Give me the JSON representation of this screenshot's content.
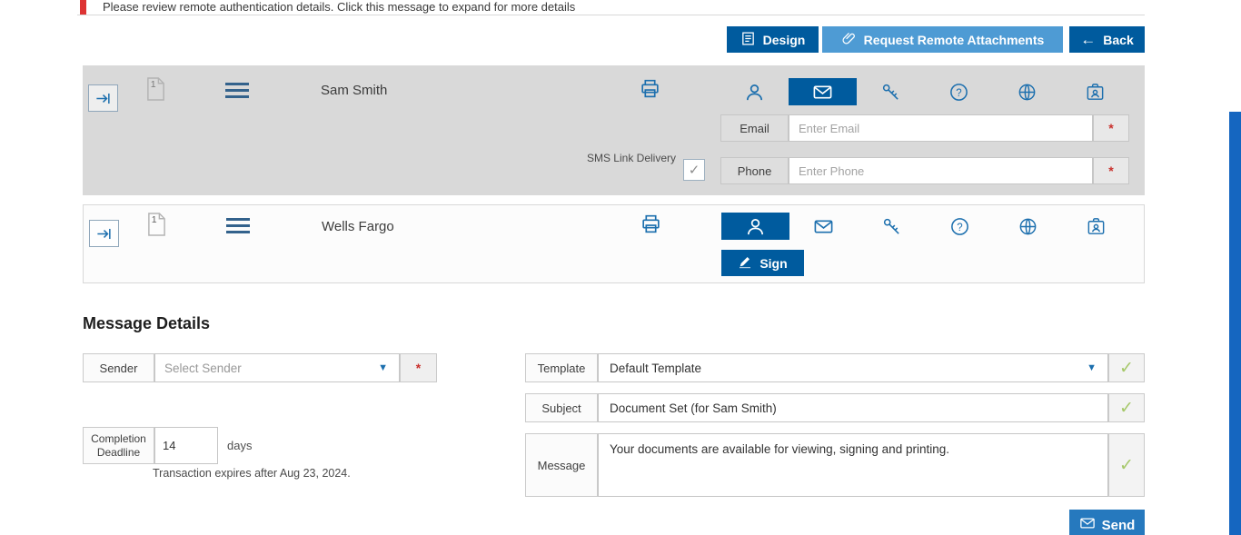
{
  "icons": {
    "back_arrow": "←",
    "caret_down": "▼",
    "check_mark": "✓",
    "required_marker": "*",
    "checkbox_check": "✓"
  },
  "colors": {
    "primary_blue": "#005b9e",
    "secondary_blue": "#4e9bd4",
    "send_blue": "#2679be",
    "icon_blue": "#1c6fae",
    "success_green": "#a6c86a",
    "required_red": "#c9302c",
    "alert_red": "#dd3333",
    "row_gray": "#d9d9d9",
    "scroll_strip_blue": "#1566c0"
  },
  "notification": {
    "text": "Please review remote authentication details. Click this message to expand for more details"
  },
  "toolbar": {
    "design": "Design",
    "request_remote_attachments": "Request Remote Attachments",
    "back": "Back"
  },
  "recipients": [
    {
      "name": "Sam Smith",
      "doc_badge": "1",
      "email_label": "Email",
      "email_placeholder": "Enter Email",
      "phone_label": "Phone",
      "phone_placeholder": "Enter Phone",
      "sms_checkbox_label": "SMS Link Delivery"
    },
    {
      "name": "Wells Fargo",
      "doc_badge": "1",
      "sign_button": "Sign"
    }
  ],
  "message_details": {
    "heading": "Message Details",
    "sender_label": "Sender",
    "sender_value": "Select Sender",
    "deadline_label": "Completion Deadline",
    "deadline_value": "14",
    "deadline_unit": "days",
    "expiry_note": "Transaction expires after Aug 23, 2024.",
    "template_label": "Template",
    "template_value": "Default Template",
    "subject_label": "Subject",
    "subject_value": "Document Set (for Sam Smith)",
    "message_label": "Message",
    "message_value": "Your documents are available for viewing, signing and printing.",
    "send_button": "Send"
  }
}
